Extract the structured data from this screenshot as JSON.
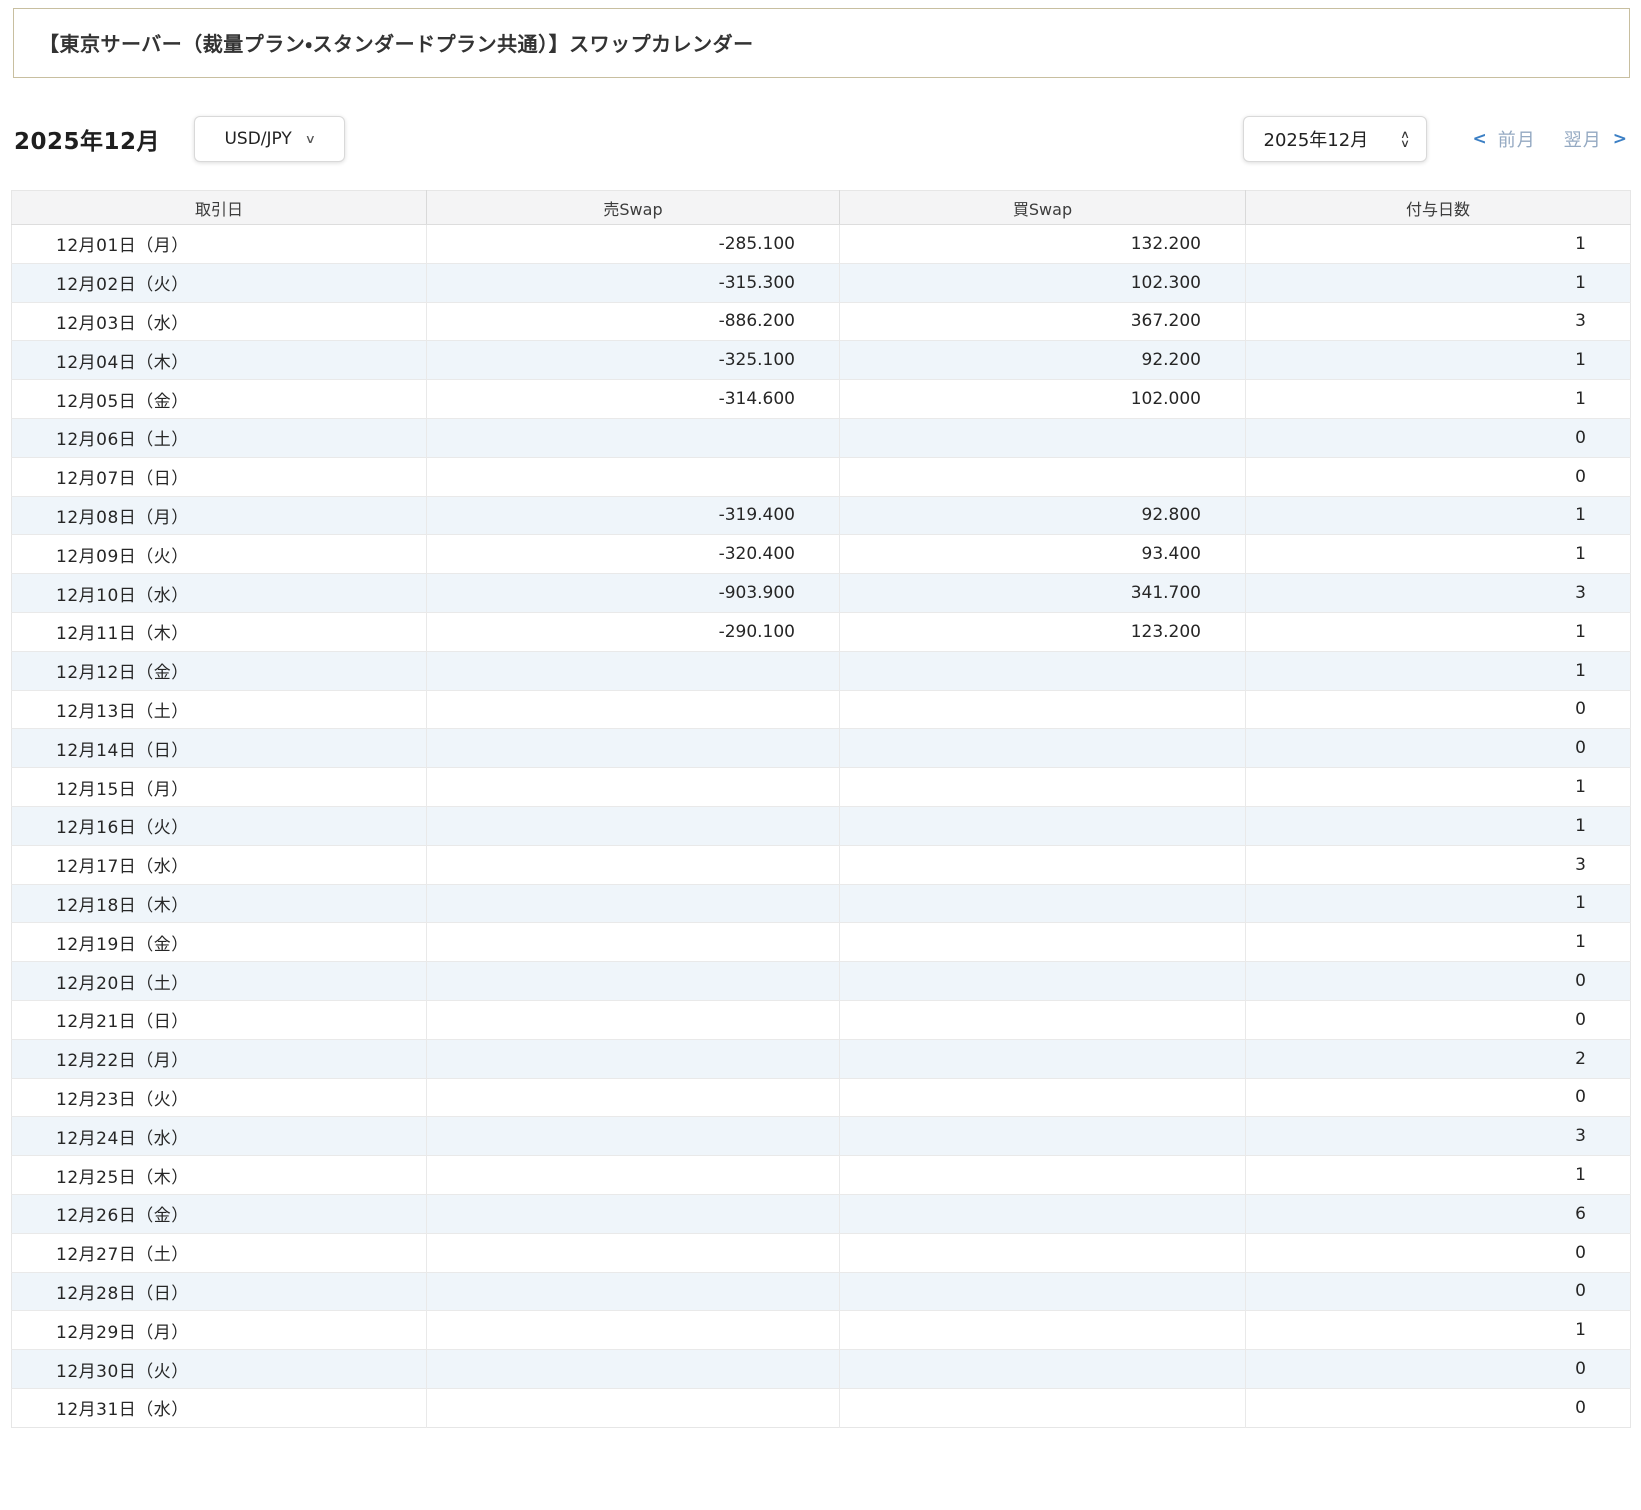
{
  "page_title": "【東京サーバー（裁量プラン・スタンダードプラン共通）】スワップカレンダー",
  "toolbar": {
    "month_heading": "2025年12月",
    "pair_selector": {
      "value": "USD/JPY"
    },
    "month_spinner": {
      "value": "2025年12月"
    },
    "prev_label": "前月",
    "next_label": "翌月"
  },
  "icons": {
    "chevron_down": "∨",
    "chevron_up": "∧",
    "chevron_left": "<",
    "chevron_right": ">"
  },
  "colors": {
    "title_border": "#c8bfa0",
    "header_bg": "#f4f4f5",
    "row_stripe": "#eff5fa",
    "nav_chevron_blue": "#3b7fc4",
    "nav_link_gray_blue": "#94a9c2"
  },
  "table": {
    "headers": [
      "取引日",
      "売Swap",
      "買Swap",
      "付与日数"
    ],
    "rows": [
      {
        "date": "12月01日（月）",
        "sell_swap": "-285.100",
        "buy_swap": "132.200",
        "days": "1"
      },
      {
        "date": "12月02日（火）",
        "sell_swap": "-315.300",
        "buy_swap": "102.300",
        "days": "1"
      },
      {
        "date": "12月03日（水）",
        "sell_swap": "-886.200",
        "buy_swap": "367.200",
        "days": "3"
      },
      {
        "date": "12月04日（木）",
        "sell_swap": "-325.100",
        "buy_swap": "92.200",
        "days": "1"
      },
      {
        "date": "12月05日（金）",
        "sell_swap": "-314.600",
        "buy_swap": "102.000",
        "days": "1"
      },
      {
        "date": "12月06日（土）",
        "sell_swap": "",
        "buy_swap": "",
        "days": "0"
      },
      {
        "date": "12月07日（日）",
        "sell_swap": "",
        "buy_swap": "",
        "days": "0"
      },
      {
        "date": "12月08日（月）",
        "sell_swap": "-319.400",
        "buy_swap": "92.800",
        "days": "1"
      },
      {
        "date": "12月09日（火）",
        "sell_swap": "-320.400",
        "buy_swap": "93.400",
        "days": "1"
      },
      {
        "date": "12月10日（水）",
        "sell_swap": "-903.900",
        "buy_swap": "341.700",
        "days": "3"
      },
      {
        "date": "12月11日（木）",
        "sell_swap": "-290.100",
        "buy_swap": "123.200",
        "days": "1"
      },
      {
        "date": "12月12日（金）",
        "sell_swap": "",
        "buy_swap": "",
        "days": "1"
      },
      {
        "date": "12月13日（土）",
        "sell_swap": "",
        "buy_swap": "",
        "days": "0"
      },
      {
        "date": "12月14日（日）",
        "sell_swap": "",
        "buy_swap": "",
        "days": "0"
      },
      {
        "date": "12月15日（月）",
        "sell_swap": "",
        "buy_swap": "",
        "days": "1"
      },
      {
        "date": "12月16日（火）",
        "sell_swap": "",
        "buy_swap": "",
        "days": "1"
      },
      {
        "date": "12月17日（水）",
        "sell_swap": "",
        "buy_swap": "",
        "days": "3"
      },
      {
        "date": "12月18日（木）",
        "sell_swap": "",
        "buy_swap": "",
        "days": "1"
      },
      {
        "date": "12月19日（金）",
        "sell_swap": "",
        "buy_swap": "",
        "days": "1"
      },
      {
        "date": "12月20日（土）",
        "sell_swap": "",
        "buy_swap": "",
        "days": "0"
      },
      {
        "date": "12月21日（日）",
        "sell_swap": "",
        "buy_swap": "",
        "days": "0"
      },
      {
        "date": "12月22日（月）",
        "sell_swap": "",
        "buy_swap": "",
        "days": "2"
      },
      {
        "date": "12月23日（火）",
        "sell_swap": "",
        "buy_swap": "",
        "days": "0"
      },
      {
        "date": "12月24日（水）",
        "sell_swap": "",
        "buy_swap": "",
        "days": "3"
      },
      {
        "date": "12月25日（木）",
        "sell_swap": "",
        "buy_swap": "",
        "days": "1"
      },
      {
        "date": "12月26日（金）",
        "sell_swap": "",
        "buy_swap": "",
        "days": "6"
      },
      {
        "date": "12月27日（土）",
        "sell_swap": "",
        "buy_swap": "",
        "days": "0"
      },
      {
        "date": "12月28日（日）",
        "sell_swap": "",
        "buy_swap": "",
        "days": "0"
      },
      {
        "date": "12月29日（月）",
        "sell_swap": "",
        "buy_swap": "",
        "days": "1"
      },
      {
        "date": "12月30日（火）",
        "sell_swap": "",
        "buy_swap": "",
        "days": "0"
      },
      {
        "date": "12月31日（水）",
        "sell_swap": "",
        "buy_swap": "",
        "days": "0"
      }
    ]
  }
}
